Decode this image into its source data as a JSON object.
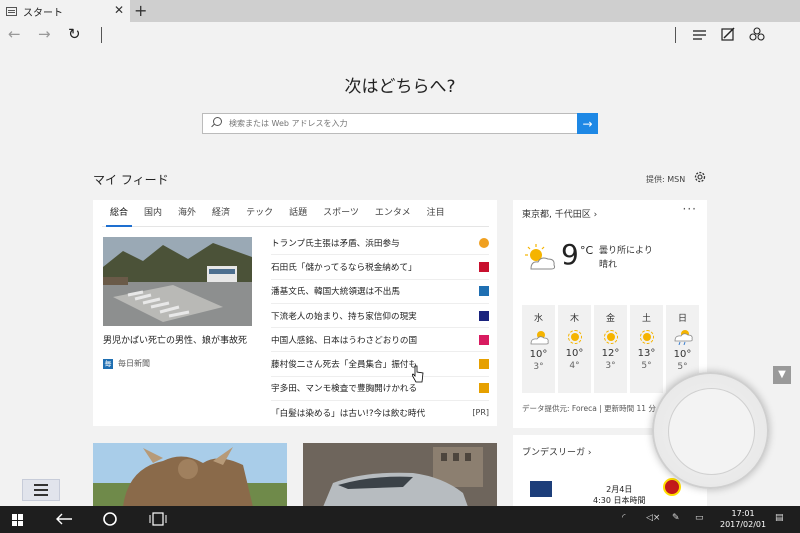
{
  "browser": {
    "tab_title": "スタート",
    "tab_close": "✕",
    "new_tab": "+"
  },
  "nav": {
    "back": "←",
    "forward": "→",
    "refresh": "↻"
  },
  "start": {
    "headline": "次はどちらへ?",
    "search_placeholder": "検索または Web アドレスを入力",
    "search_go": "→"
  },
  "feed": {
    "title": "マイ フィード",
    "provider": "提供: MSN",
    "tabs": [
      "総合",
      "国内",
      "海外",
      "経済",
      "テック",
      "話題",
      "スポーツ",
      "エンタメ",
      "注目"
    ],
    "main_caption": "男児かばい死亡の男性、娘が事故死",
    "main_source": "毎日新聞",
    "headlines": [
      {
        "text": "トランプ氏主張は矛盾、浜田参与",
        "badge_color": "#f0a020"
      },
      {
        "text": "石田氏「儲かってるなら税金納めて」",
        "badge_color": "#c8102e"
      },
      {
        "text": "潘基文氏、韓国大統領選は不出馬",
        "badge_color": "#1f6fb2"
      },
      {
        "text": "下流老人の始まり、持ち家信仰の現実",
        "badge_color": "#1a237e"
      },
      {
        "text": "中国人感銘、日本はうわさどおりの国",
        "badge_color": "#d81b60"
      },
      {
        "text": "藤村俊二さん死去「全員集合」振付も",
        "badge_color": "#e6a000"
      },
      {
        "text": "宇多田、マンモ検査で豊胸開けかれる",
        "badge_color": "#e6a000"
      },
      {
        "text": "「白髪は染める」は古い!?今は飲む時代",
        "badge": "[PR]"
      }
    ]
  },
  "weather": {
    "location": "東京都, 千代田区 ›",
    "more": "···",
    "temp": "9",
    "unit": "°C",
    "desc": "曇り所により晴れ",
    "days": [
      {
        "day": "水",
        "hi": "10°",
        "lo": "3°"
      },
      {
        "day": "木",
        "hi": "10°",
        "lo": "4°"
      },
      {
        "day": "金",
        "hi": "12°",
        "lo": "3°"
      },
      {
        "day": "土",
        "hi": "13°",
        "lo": "5°"
      },
      {
        "day": "日",
        "hi": "10°",
        "lo": "5°"
      }
    ],
    "footer": "データ提供元: Foreca | 更新時間 11 分"
  },
  "sports": {
    "title": "ブンデスリーガ ›",
    "date": "2月4日",
    "time": "4:30 日本時間"
  },
  "taskbar": {
    "time": "17:01",
    "date": "2017/02/01"
  }
}
